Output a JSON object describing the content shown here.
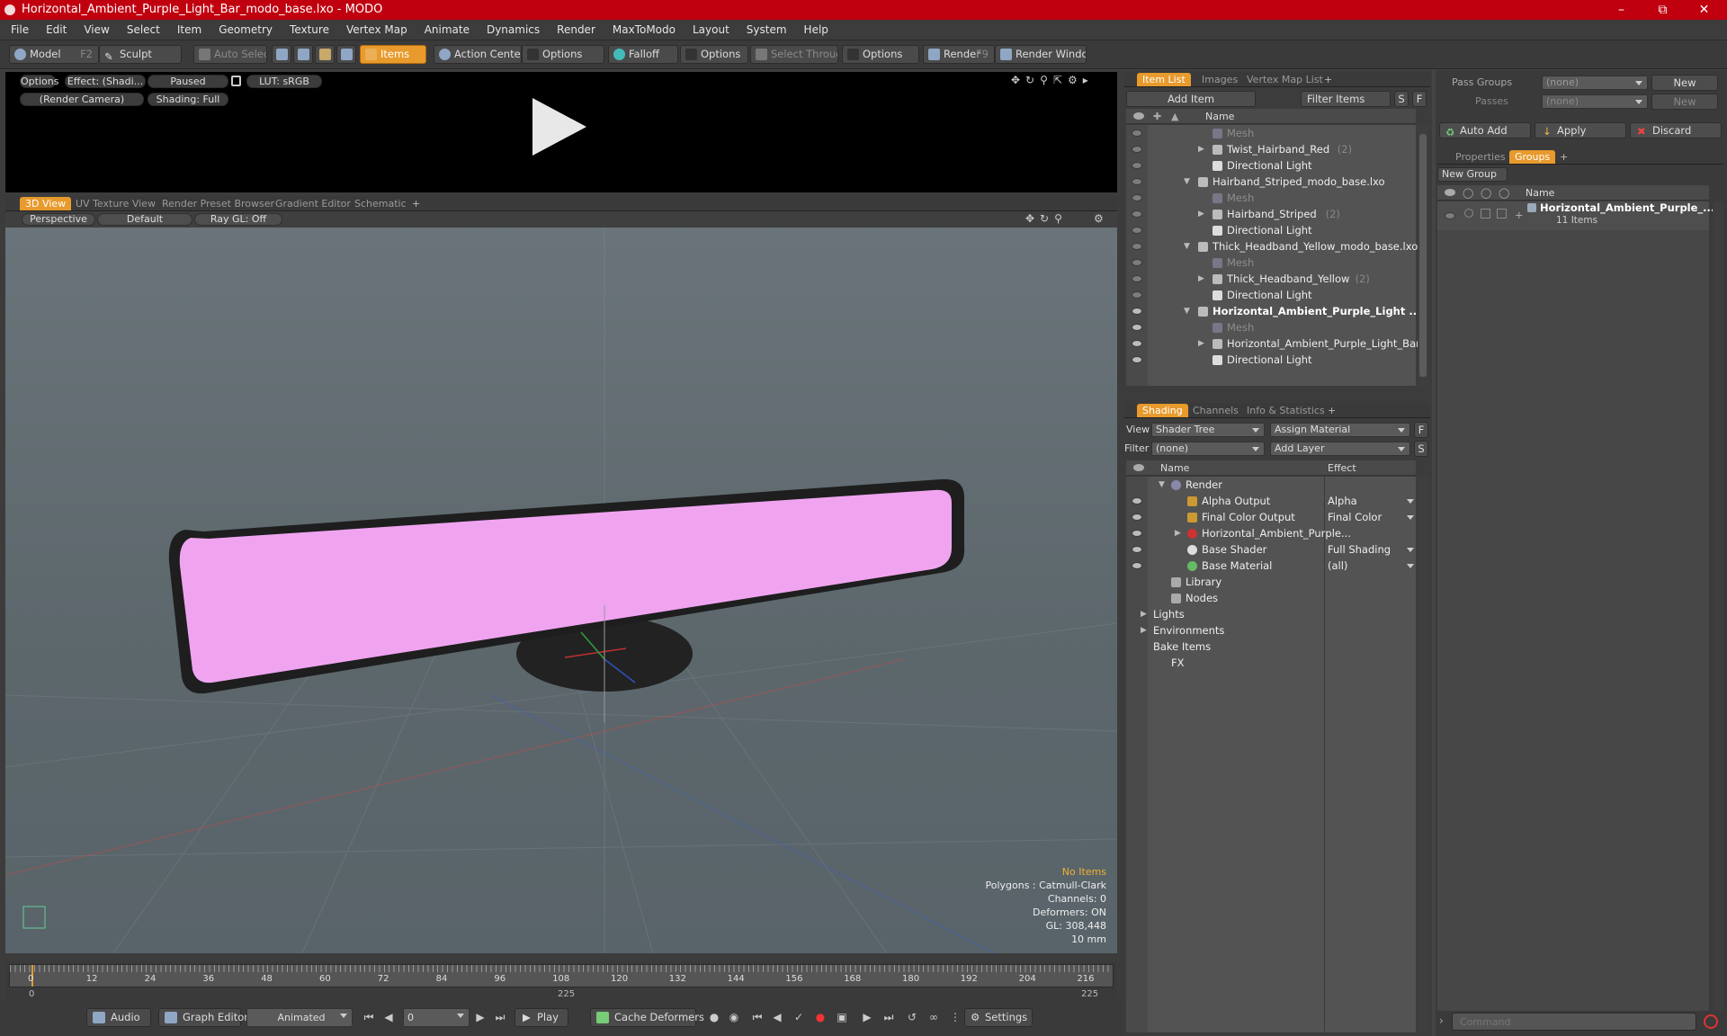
{
  "window": {
    "title": "Horizontal_Ambient_Purple_Light_Bar_modo_base.lxo - MODO"
  },
  "menu": [
    "File",
    "Edit",
    "View",
    "Select",
    "Item",
    "Geometry",
    "Texture",
    "Vertex Map",
    "Animate",
    "Dynamics",
    "Render",
    "MaxToModo",
    "Layout",
    "System",
    "Help"
  ],
  "toolbar": {
    "model": "Model",
    "model_key": "F2",
    "sculpt": "Sculpt",
    "auto_select": "Auto Select",
    "items": "Items",
    "action_center": "Action Center",
    "options1": "Options",
    "falloff": "Falloff",
    "options2": "Options",
    "select_through": "Select Through",
    "options3": "Options",
    "render": "Render",
    "render_key": "F9",
    "render_window": "Render Window"
  },
  "render_panel": {
    "options": "Options",
    "effect": "Effect: (Shadi...",
    "paused": "Paused",
    "lut": "LUT: sRGB",
    "camera": "(Render Camera)",
    "shading": "Shading: Full"
  },
  "view_tabs": [
    "3D View",
    "UV Texture View",
    "Render Preset Browser",
    "Gradient Editor",
    "Schematic"
  ],
  "viewport": {
    "perspective": "Perspective",
    "default": "Default",
    "raygl": "Ray GL: Off",
    "stats": {
      "no_items": "No Items",
      "polygons": "Polygons : Catmull-Clark",
      "channels": "Channels: 0",
      "deformers": "Deformers: ON",
      "gl": "GL: 308,448",
      "scale": "10 mm"
    }
  },
  "timeline": {
    "ticks": [
      "0",
      "12",
      "24",
      "36",
      "48",
      "60",
      "72",
      "84",
      "96",
      "108",
      "120",
      "132",
      "144",
      "156",
      "168",
      "180",
      "192",
      "204",
      "216"
    ],
    "start": "0",
    "mid": "225",
    "end": "225"
  },
  "bottombar": {
    "audio": "Audio",
    "graph_editor": "Graph Editor",
    "animated": "Animated",
    "frame": "0",
    "play": "Play",
    "cache_deformers": "Cache Deformers",
    "settings": "Settings"
  },
  "item_list": {
    "tabs": [
      "Item List",
      "Images",
      "Vertex Map List"
    ],
    "add_item": "Add Item",
    "filter_items": "Filter Items",
    "s": "S",
    "f": "F",
    "col_name": "Name",
    "rows": [
      {
        "label": "Mesh",
        "dim": true
      },
      {
        "label": "Twist_Hairband_Red",
        "count": "(2)"
      },
      {
        "label": "Directional Light"
      },
      {
        "label": "Hairband_Striped_modo_base.lxo"
      },
      {
        "label": "Mesh",
        "dim": true
      },
      {
        "label": "Hairband_Striped",
        "count": "(2)"
      },
      {
        "label": "Directional Light"
      },
      {
        "label": "Thick_Headband_Yellow_modo_base.lxo"
      },
      {
        "label": "Mesh",
        "dim": true
      },
      {
        "label": "Thick_Headband_Yellow",
        "count": "(2)"
      },
      {
        "label": "Directional Light"
      },
      {
        "label": "Horizontal_Ambient_Purple_Light ...",
        "bold": true
      },
      {
        "label": "Mesh",
        "dim": true
      },
      {
        "label": "Horizontal_Ambient_Purple_Light_Bar"
      },
      {
        "label": "Directional Light"
      }
    ]
  },
  "shading": {
    "tabs": [
      "Shading",
      "Channels",
      "Info & Statistics"
    ],
    "view_label": "View",
    "view_value": "Shader Tree",
    "assign_material": "Assign Material",
    "filter_label": "Filter",
    "filter_value": "(none)",
    "add_layer": "Add Layer",
    "f": "F",
    "s": "S",
    "col_name": "Name",
    "col_effect": "Effect",
    "rows": [
      {
        "label": "Render",
        "effect": ""
      },
      {
        "label": "Alpha Output",
        "effect": "Alpha"
      },
      {
        "label": "Final Color Output",
        "effect": "Final Color"
      },
      {
        "label": "Horizontal_Ambient_Purple...",
        "effect": ""
      },
      {
        "label": "Base Shader",
        "effect": "Full Shading"
      },
      {
        "label": "Base Material",
        "effect": "(all)"
      },
      {
        "label": "Library",
        "effect": ""
      },
      {
        "label": "Nodes",
        "effect": ""
      },
      {
        "label": "Lights",
        "effect": ""
      },
      {
        "label": "Environments",
        "effect": ""
      },
      {
        "label": "Bake Items",
        "effect": ""
      },
      {
        "label": "FX",
        "effect": ""
      }
    ]
  },
  "groups": {
    "pass_groups": "Pass Groups",
    "pass_value": "(none)",
    "new1": "New",
    "passes": "Passes",
    "passes_value": "(none)",
    "new2": "New",
    "auto_add": "Auto Add",
    "apply": "Apply",
    "discard": "Discard",
    "tabs": [
      "Properties",
      "Groups"
    ],
    "new_group": "New Group",
    "col_name": "Name",
    "item": "Horizontal_Ambient_Purple_...",
    "item_count": "11 Items"
  },
  "command": {
    "placeholder": "Command"
  },
  "colors": {
    "accent": "#e89a2c",
    "titlebar": "#c0000f",
    "lightbar": "#f4a8f4"
  }
}
